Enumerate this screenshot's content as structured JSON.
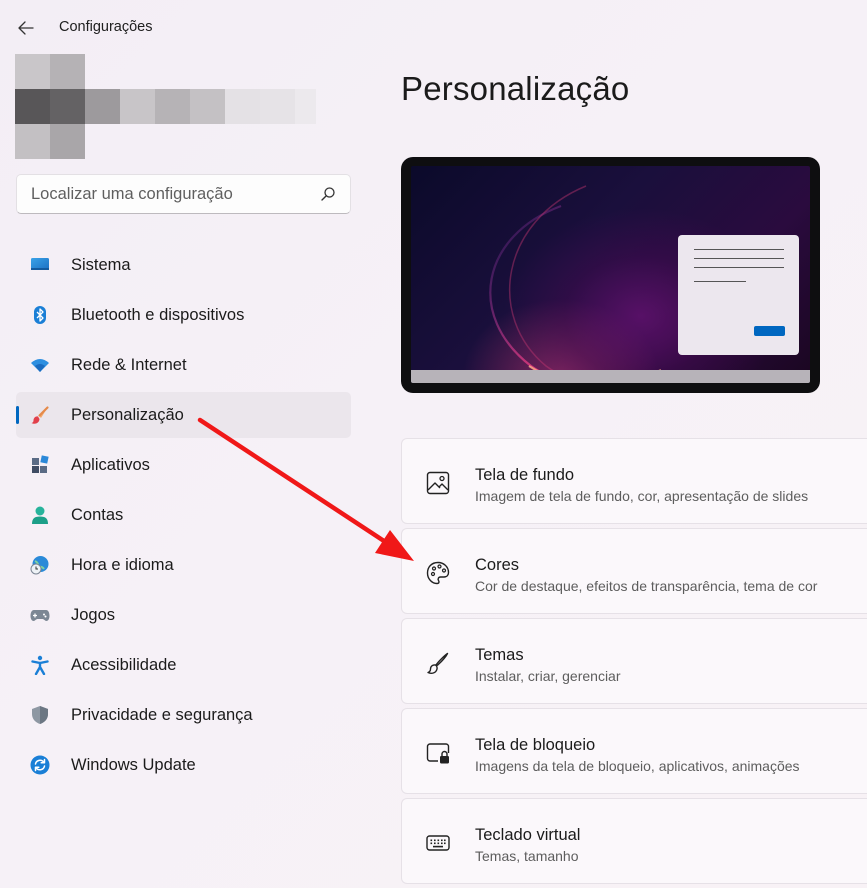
{
  "window": {
    "title": "Configurações"
  },
  "search": {
    "placeholder": "Localizar uma configuração"
  },
  "sidebar": {
    "items": [
      {
        "label": "Sistema",
        "icon": "monitor-icon",
        "active": false
      },
      {
        "label": "Bluetooth e dispositivos",
        "icon": "bluetooth-icon",
        "active": false
      },
      {
        "label": "Rede & Internet",
        "icon": "wifi-icon",
        "active": false
      },
      {
        "label": "Personalização",
        "icon": "paintbrush-icon",
        "active": true
      },
      {
        "label": "Aplicativos",
        "icon": "apps-icon",
        "active": false
      },
      {
        "label": "Contas",
        "icon": "person-icon",
        "active": false
      },
      {
        "label": "Hora e idioma",
        "icon": "globe-clock-icon",
        "active": false
      },
      {
        "label": "Jogos",
        "icon": "gamepad-icon",
        "active": false
      },
      {
        "label": "Acessibilidade",
        "icon": "accessibility-icon",
        "active": false
      },
      {
        "label": "Privacidade e segurança",
        "icon": "shield-icon",
        "active": false
      },
      {
        "label": "Windows Update",
        "icon": "sync-icon",
        "active": false
      }
    ]
  },
  "main": {
    "title": "Personalização",
    "cards": [
      {
        "title": "Tela de fundo",
        "subtitle": "Imagem de tela de fundo, cor, apresentação de slides",
        "icon": "image-icon"
      },
      {
        "title": "Cores",
        "subtitle": "Cor de destaque, efeitos de transparência, tema de cor",
        "icon": "palette-icon"
      },
      {
        "title": "Temas",
        "subtitle": "Instalar, criar, gerenciar",
        "icon": "brush-icon"
      },
      {
        "title": "Tela de bloqueio",
        "subtitle": "Imagens da tela de bloqueio, aplicativos, animações",
        "icon": "lock-screen-icon"
      },
      {
        "title": "Teclado virtual",
        "subtitle": "Temas, tamanho",
        "icon": "keyboard-icon"
      }
    ]
  },
  "colors": {
    "accent": "#0067c0",
    "annotation_arrow": "#f01818",
    "active_nav_bg": "#ebe6ec"
  }
}
